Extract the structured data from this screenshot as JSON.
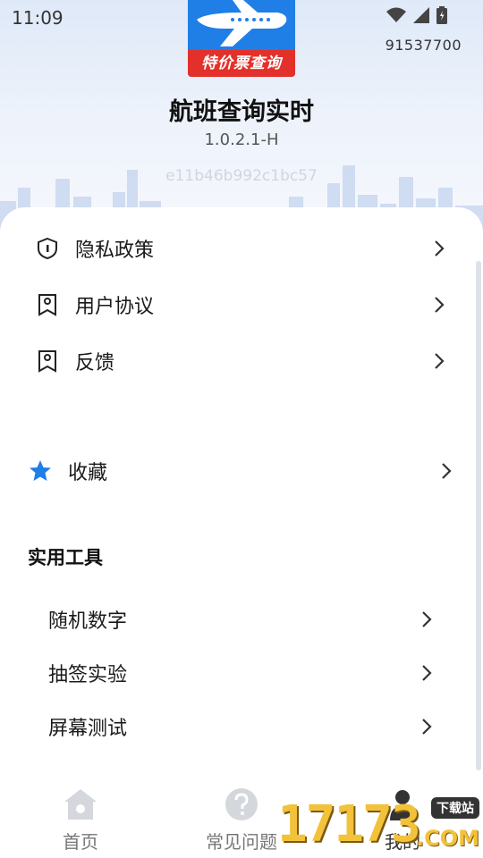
{
  "status_bar": {
    "time": "11:09",
    "icons": [
      "wifi-icon",
      "signal-icon",
      "battery-icon"
    ]
  },
  "device_id": "91537700",
  "app": {
    "logo_text": "特价票查询",
    "title": "航班查询实时",
    "version": "1.0.2.1-H",
    "hash": "e11b46b992c1bc57"
  },
  "menu": [
    {
      "label": "隐私政策",
      "icon": "shield-lock-icon"
    },
    {
      "label": "用户协议",
      "icon": "user-doc-icon"
    },
    {
      "label": "反馈",
      "icon": "feedback-doc-icon"
    }
  ],
  "favorites": {
    "label": "收藏",
    "icon": "star-icon"
  },
  "tools": {
    "title": "实用工具",
    "items": [
      {
        "label": "随机数字"
      },
      {
        "label": "抽签实验"
      },
      {
        "label": "屏幕测试"
      }
    ]
  },
  "tabbar": {
    "tabs": [
      {
        "label": "首页",
        "icon": "home-icon"
      },
      {
        "label": "常见问题",
        "icon": "question-icon"
      },
      {
        "label": "我的",
        "icon": "profile-icon"
      }
    ],
    "active": "我的"
  },
  "watermark": {
    "number": "17173",
    "badge": "下载站",
    "suffix": ".COM"
  },
  "colors": {
    "accent": "#1f7fe6",
    "logo_band": "#e3302a",
    "star": "#1f7fe6"
  }
}
